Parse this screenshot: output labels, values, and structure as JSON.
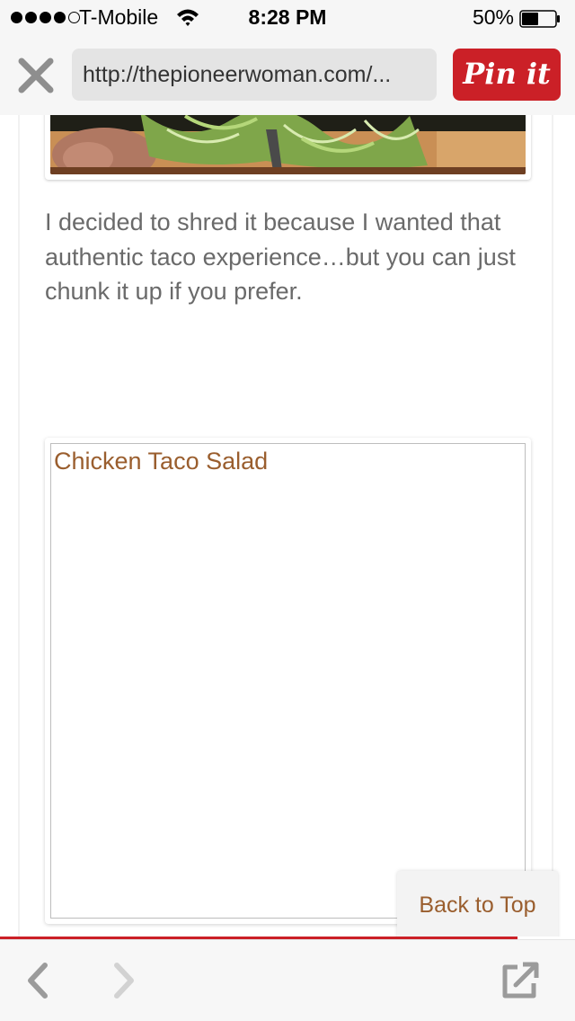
{
  "status_bar": {
    "signal_bars_filled": 4,
    "signal_bars_total": 5,
    "carrier": "T-Mobile",
    "time": "8:28 PM",
    "battery_percent": "50%",
    "battery_level": 0.5
  },
  "toolbar": {
    "close_icon": "close-x-icon",
    "url": "http://thepioneerwoman.com/...",
    "pin_label": "Pin it",
    "pin_color": "#cb2027"
  },
  "article": {
    "paragraph": "I decided to shred it because I wanted that authentic taco experience…but you can just chunk it up if you prefer.",
    "embed_title": "Chicken Taco Salad",
    "link_color": "#9a5e2e"
  },
  "back_to_top": {
    "label": "Back to Top"
  },
  "bottom_bar": {
    "back_icon": "chevron-left-icon",
    "forward_icon": "chevron-right-icon",
    "share_icon": "open-external-icon"
  }
}
